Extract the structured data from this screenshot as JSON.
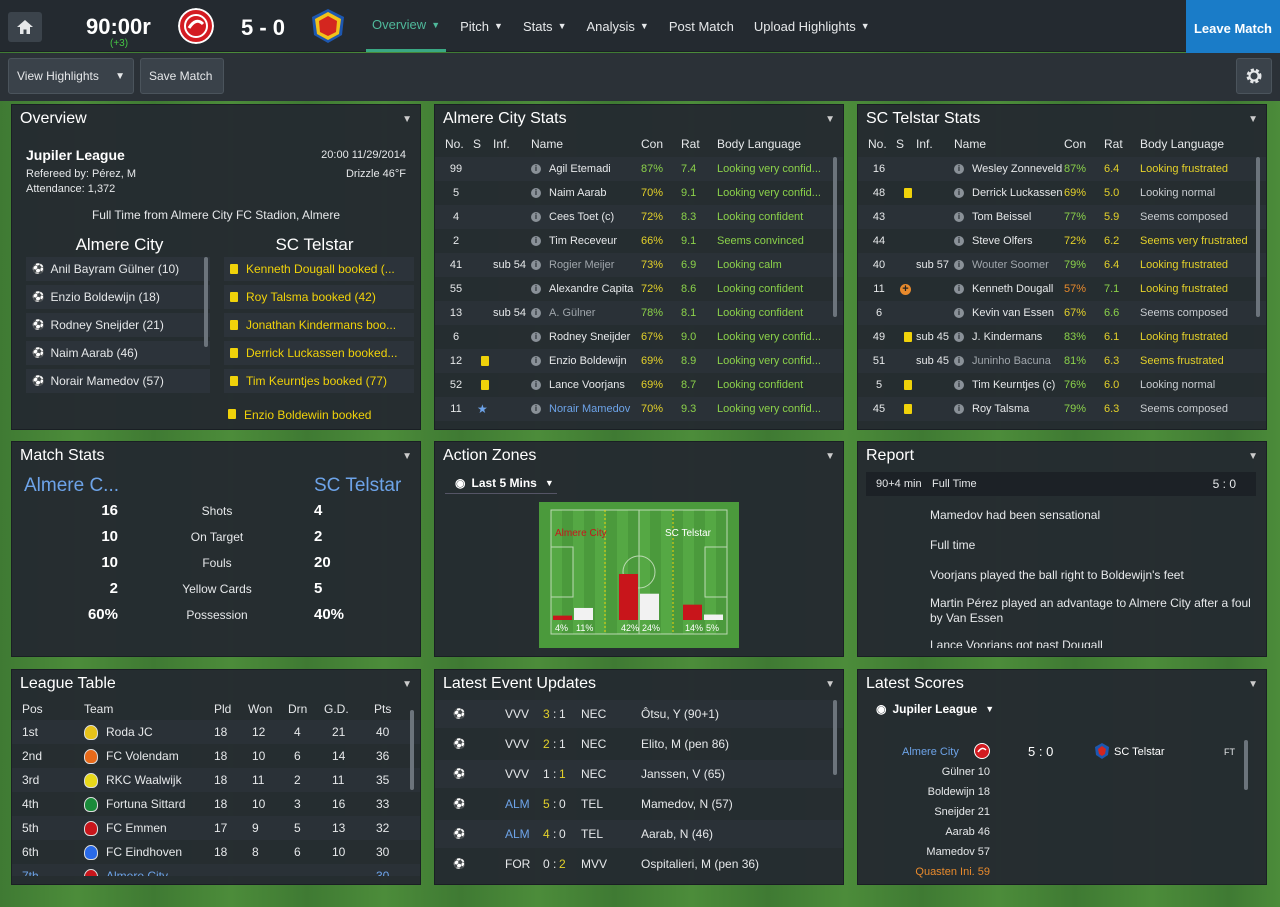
{
  "header": {
    "clock": "90:00r",
    "added_time": "(+3)",
    "score": "5 - 0",
    "home_icon": "home-icon",
    "nav": [
      {
        "label": "Overview",
        "dropdown": true
      },
      {
        "label": "Pitch",
        "dropdown": true
      },
      {
        "label": "Stats",
        "dropdown": true
      },
      {
        "label": "Analysis",
        "dropdown": true
      },
      {
        "label": "Post Match",
        "dropdown": false
      },
      {
        "label": "Upload Highlights",
        "dropdown": true
      }
    ],
    "leave": "Leave Match"
  },
  "toolbar": {
    "view_highlights": "View Highlights",
    "save_match": "Save Match"
  },
  "colors": {
    "accent": "#3aa883",
    "leave": "#1a7cc8",
    "home_team": "#c8151b",
    "yellow_card": "#f0d20a",
    "good": "#8bd14a",
    "warn": "#e4d12a"
  },
  "overview": {
    "title": "Overview",
    "league": "Jupiler League",
    "datetime": "20:00 11/29/2014",
    "referee": "Refereed by: Pérez, M",
    "weather": "Drizzle 46°F",
    "attendance": "Attendance: 1,372",
    "status": "Full Time from Almere City FC Stadion, Almere",
    "home": "Almere City",
    "away": "SC Telstar",
    "home_events": [
      "Anil Bayram Gülner (10)",
      "Enzio Boldewijn (18)",
      "Rodney Sneijder (21)",
      "Naim Aarab (46)",
      "Norair Mamedov (57)"
    ],
    "away_events": [
      "Kenneth Dougall booked (...",
      "Roy Talsma booked (42)",
      "Jonathan Kindermans boo...",
      "Derrick Luckassen booked...",
      "Tim Keurntjes booked (77)"
    ],
    "cut_event": "Enzio Boldewijn booked"
  },
  "almere_stats": {
    "title": "Almere City Stats",
    "cols": [
      "No.",
      "S",
      "Inf.",
      "Name",
      "Con",
      "Rat",
      "Body Language"
    ],
    "rows": [
      {
        "no": "99",
        "s": "",
        "inf": "",
        "name": "Agil Etemadi",
        "con": "87%",
        "rat": "7.4",
        "body": "Looking very confid..."
      },
      {
        "no": "5",
        "s": "",
        "inf": "",
        "name": "Naim Aarab",
        "con": "70%",
        "rat": "9.1",
        "body": "Looking very confid..."
      },
      {
        "no": "4",
        "s": "",
        "inf": "",
        "name": "Cees Toet (c)",
        "con": "72%",
        "rat": "8.3",
        "body": "Looking confident"
      },
      {
        "no": "2",
        "s": "",
        "inf": "",
        "name": "Tim Receveur",
        "con": "66%",
        "rat": "9.1",
        "body": "Seems convinced"
      },
      {
        "no": "41",
        "s": "",
        "inf": "sub 54",
        "name": "Rogier Meijer",
        "con": "73%",
        "rat": "6.9",
        "body": "Looking calm"
      },
      {
        "no": "55",
        "s": "",
        "inf": "",
        "name": "Alexandre Capita",
        "con": "72%",
        "rat": "8.6",
        "body": "Looking confident"
      },
      {
        "no": "13",
        "s": "",
        "inf": "sub 54",
        "name": "A. Gülner",
        "con": "78%",
        "rat": "8.1",
        "body": "Looking confident"
      },
      {
        "no": "6",
        "s": "",
        "inf": "",
        "name": "Rodney Sneijder",
        "con": "67%",
        "rat": "9.0",
        "body": "Looking very confid..."
      },
      {
        "no": "12",
        "s": "yellow",
        "inf": "",
        "name": "Enzio Boldewijn",
        "con": "69%",
        "rat": "8.9",
        "body": "Looking very confid..."
      },
      {
        "no": "52",
        "s": "yellow",
        "inf": "",
        "name": "Lance Voorjans",
        "con": "69%",
        "rat": "8.7",
        "body": "Looking confident"
      },
      {
        "no": "11",
        "s": "star",
        "inf": "",
        "name": "Norair Mamedov",
        "con": "70%",
        "rat": "9.3",
        "body": "Looking very confid..."
      }
    ]
  },
  "telstar_stats": {
    "title": "SC Telstar Stats",
    "cols": [
      "No.",
      "S",
      "Inf.",
      "Name",
      "Con",
      "Rat",
      "Body Language"
    ],
    "rows": [
      {
        "no": "16",
        "s": "",
        "inf": "",
        "name": "Wesley Zonneveld",
        "con": "87%",
        "rat": "6.4",
        "body": "Looking frustrated"
      },
      {
        "no": "48",
        "s": "yellow",
        "inf": "",
        "name": "Derrick Luckassen",
        "con": "69%",
        "rat": "5.0",
        "body": "Looking normal"
      },
      {
        "no": "43",
        "s": "",
        "inf": "",
        "name": "Tom Beissel",
        "con": "77%",
        "rat": "5.9",
        "body": "Seems composed"
      },
      {
        "no": "44",
        "s": "",
        "inf": "",
        "name": "Steve Olfers",
        "con": "72%",
        "rat": "6.2",
        "body": "Seems very frustrated"
      },
      {
        "no": "40",
        "s": "",
        "inf": "sub 57",
        "name": "Wouter Soomer",
        "con": "79%",
        "rat": "6.4",
        "body": "Looking frustrated"
      },
      {
        "no": "11",
        "s": "injury",
        "inf": "",
        "name": "Kenneth Dougall",
        "con": "57%",
        "rat": "7.1",
        "body": "Looking frustrated"
      },
      {
        "no": "6",
        "s": "",
        "inf": "",
        "name": "Kevin van Essen",
        "con": "67%",
        "rat": "6.6",
        "body": "Seems composed"
      },
      {
        "no": "49",
        "s": "yellow",
        "inf": "sub 45",
        "name": "J. Kindermans",
        "con": "83%",
        "rat": "6.1",
        "body": "Looking frustrated"
      },
      {
        "no": "51",
        "s": "",
        "inf": "sub 45",
        "name": "Juninho Bacuna",
        "con": "81%",
        "rat": "6.3",
        "body": "Seems frustrated"
      },
      {
        "no": "5",
        "s": "yellow",
        "inf": "",
        "name": "Tim Keurntjes (c)",
        "con": "76%",
        "rat": "6.0",
        "body": "Looking normal"
      },
      {
        "no": "45",
        "s": "yellow",
        "inf": "",
        "name": "Roy Talsma",
        "con": "79%",
        "rat": "6.3",
        "body": "Seems composed"
      }
    ]
  },
  "match_stats": {
    "title": "Match Stats",
    "home": "Almere C...",
    "away": "SC Telstar",
    "rows": [
      {
        "h": "16",
        "label": "Shots",
        "a": "4"
      },
      {
        "h": "10",
        "label": "On Target",
        "a": "2"
      },
      {
        "h": "10",
        "label": "Fouls",
        "a": "20"
      },
      {
        "h": "2",
        "label": "Yellow Cards",
        "a": "5"
      },
      {
        "h": "60%",
        "label": "Possession",
        "a": "40%"
      }
    ]
  },
  "action_zones": {
    "title": "Action Zones",
    "filter": "Last 5 Mins",
    "home": "Almere City",
    "away": "SC Telstar",
    "zones": [
      {
        "home": 4,
        "away": 11,
        "home_label": "4%",
        "away_label": "11%"
      },
      {
        "home": 42,
        "away": 24,
        "home_label": "42%",
        "away_label": "24%"
      },
      {
        "home": 14,
        "away": 5,
        "home_label": "14%",
        "away_label": "5%"
      }
    ]
  },
  "report": {
    "title": "Report",
    "time": "90+4 min",
    "event": "Full Time",
    "score": "5 : 0",
    "lines": [
      "Mamedov had been sensational",
      "Full time",
      "Voorjans played the ball right to Boldewijn's feet",
      "Martin Pérez played an advantage to Almere City after a foul by Van Essen",
      "Lance Voorjans got past Dougall"
    ]
  },
  "league_table": {
    "title": "League Table",
    "cols": [
      "Pos",
      "Team",
      "Pld",
      "Won",
      "Drn",
      "G.D.",
      "Pts"
    ],
    "rows": [
      {
        "pos": "1st",
        "team": "Roda JC",
        "pld": "18",
        "won": "12",
        "drn": "4",
        "gd": "21",
        "pts": "40"
      },
      {
        "pos": "2nd",
        "team": "FC Volendam",
        "pld": "18",
        "won": "10",
        "drn": "6",
        "gd": "14",
        "pts": "36"
      },
      {
        "pos": "3rd",
        "team": "RKC Waalwijk",
        "pld": "18",
        "won": "11",
        "drn": "2",
        "gd": "11",
        "pts": "35"
      },
      {
        "pos": "4th",
        "team": "Fortuna Sittard",
        "pld": "18",
        "won": "10",
        "drn": "3",
        "gd": "16",
        "pts": "33"
      },
      {
        "pos": "5th",
        "team": "FC Emmen",
        "pld": "17",
        "won": "9",
        "drn": "5",
        "gd": "13",
        "pts": "32"
      },
      {
        "pos": "6th",
        "team": "FC Eindhoven",
        "pld": "18",
        "won": "8",
        "drn": "6",
        "gd": "10",
        "pts": "30"
      },
      {
        "pos": "7th",
        "team": "Almere City",
        "pld": "",
        "won": "",
        "drn": "",
        "gd": "",
        "pts": "30"
      }
    ]
  },
  "events": {
    "title": "Latest Event Updates",
    "rows": [
      {
        "home": "VVV",
        "hs": "3",
        "as": "1",
        "away": "NEC",
        "desc": "Ôtsu, Y (90+1)",
        "hl": "home"
      },
      {
        "home": "VVV",
        "hs": "2",
        "as": "1",
        "away": "NEC",
        "desc": "Elito, M (pen 86)",
        "hl": "home"
      },
      {
        "home": "VVV",
        "hs": "1",
        "as": "1",
        "away": "NEC",
        "desc": "Janssen, V (65)",
        "hl": "away"
      },
      {
        "home": "ALM",
        "hs": "5",
        "as": "0",
        "away": "TEL",
        "desc": "Mamedov, N (57)",
        "hl": "home"
      },
      {
        "home": "ALM",
        "hs": "4",
        "as": "0",
        "away": "TEL",
        "desc": "Aarab, N (46)",
        "hl": "home"
      },
      {
        "home": "FOR",
        "hs": "0",
        "as": "2",
        "away": "MVV",
        "desc": "Ospitalieri, M (pen 36)",
        "hl": "away"
      }
    ]
  },
  "scores": {
    "title": "Latest Scores",
    "filter": "Jupiler League",
    "home": "Almere City",
    "score": "5 : 0",
    "away": "SC Telstar",
    "status": "FT",
    "scorers": [
      "Gülner 10",
      "Boldewijn 18",
      "Sneijder 21",
      "Aarab 46",
      "Mamedov 57"
    ],
    "red": "Quasten Ini. 59"
  }
}
